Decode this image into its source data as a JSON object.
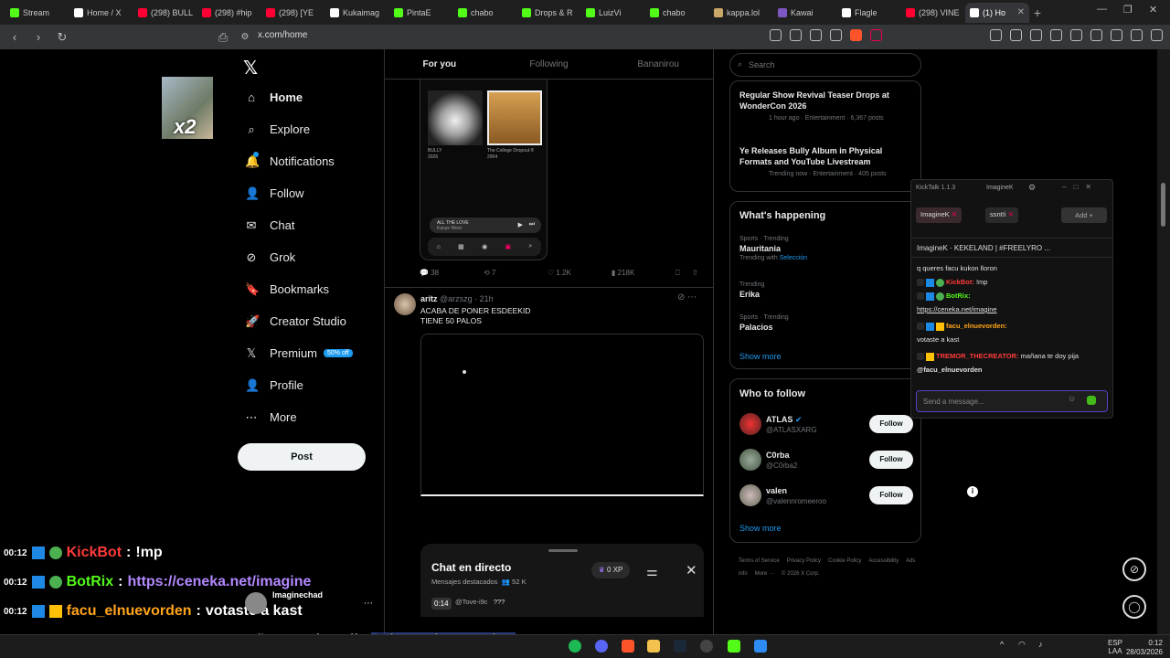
{
  "browser": {
    "tabs": [
      {
        "label": "Stream",
        "icon": "kick-icon",
        "color": "#53fc18"
      },
      {
        "label": "Home / X",
        "icon": "x-icon",
        "color": "#ffffff"
      },
      {
        "label": "(298) BULL",
        "icon": "youtube-icon",
        "color": "#ff0033"
      },
      {
        "label": "(298) #hip",
        "icon": "youtube-icon",
        "color": "#ff0033"
      },
      {
        "label": "(298) [YE",
        "icon": "youtube-icon",
        "color": "#ff0033"
      },
      {
        "label": "Kukaimag",
        "icon": "tiktok-icon",
        "color": "#ffffff"
      },
      {
        "label": "PintaE",
        "icon": "kick-icon",
        "color": "#53fc18"
      },
      {
        "label": "chabo",
        "icon": "kick-icon",
        "color": "#53fc18"
      },
      {
        "label": "Drops & R",
        "icon": "kick-icon",
        "color": "#53fc18"
      },
      {
        "label": "LuizVi",
        "icon": "kick-icon",
        "color": "#53fc18"
      },
      {
        "label": "chabo",
        "icon": "kick-icon",
        "color": "#53fc18"
      },
      {
        "label": "kappa.lol",
        "icon": "kappa-icon",
        "color": "#c9a86a"
      },
      {
        "label": "Kawai",
        "icon": "kawai-icon",
        "color": "#7e57c2"
      },
      {
        "label": "Flagle",
        "icon": "globe-icon",
        "color": "#ffffff"
      },
      {
        "label": "(298) VINE",
        "icon": "youtube-icon",
        "color": "#ff0033"
      },
      {
        "label": "(1) Ho",
        "icon": "x-icon",
        "color": "#ffffff"
      }
    ],
    "url": "x.com/home"
  },
  "overlay_x2": "x2",
  "nav": {
    "items": [
      {
        "label": "Home",
        "icon": "home-icon",
        "glyph": "⌂"
      },
      {
        "label": "Explore",
        "icon": "search-icon",
        "glyph": "⌕"
      },
      {
        "label": "Notifications",
        "icon": "bell-icon",
        "glyph": "🔔"
      },
      {
        "label": "Follow",
        "icon": "follow-icon",
        "glyph": "👤"
      },
      {
        "label": "Chat",
        "icon": "mail-icon",
        "glyph": "✉"
      },
      {
        "label": "Grok",
        "icon": "grok-icon",
        "glyph": "⊘"
      },
      {
        "label": "Bookmarks",
        "icon": "bookmark-icon",
        "glyph": "🔖"
      },
      {
        "label": "Creator Studio",
        "icon": "rocket-icon",
        "glyph": "🚀"
      },
      {
        "label": "Premium",
        "icon": "x-premium-icon",
        "glyph": "𝕏"
      },
      {
        "label": "Profile",
        "icon": "person-icon",
        "glyph": "👤"
      },
      {
        "label": "More",
        "icon": "more-circle-icon",
        "glyph": "⋯"
      }
    ],
    "premium_badge": "50% off",
    "post_label": "Post"
  },
  "feed": {
    "tabs": [
      "For you",
      "Following",
      "Bananirou"
    ],
    "phone": {
      "album1_caption": "BULLY",
      "album1_year": "2026",
      "album2_caption": "The College Dropout ®",
      "album2_year": "2004",
      "now_playing": "ALL THE LOVE",
      "now_playing_artist": "Kanye West"
    },
    "tweet1_stats": {
      "replies": "38",
      "reposts": "7",
      "likes": "1.2K",
      "views": "218K"
    },
    "tweet2": {
      "name": "aritz",
      "handle": "@arzszg · 21h",
      "line1": "ACABA DE PONER ESDEEKID",
      "line2": "TIENE 50 PALOS"
    },
    "live_chat": {
      "title": "Chat en directo",
      "subtitle": "Mensajes destacados",
      "viewers": "52 K",
      "xp": "0 XP",
      "time": "0:14",
      "user": "@Tove-i9c",
      "msg": "???"
    }
  },
  "right": {
    "search_placeholder": "Search",
    "news": [
      {
        "title": "Regular Show Revival Teaser Drops at WonderCon 2026",
        "meta": "1 hour ago · Entertainment · 6,367 posts"
      },
      {
        "title": "Ye Releases Bully Album in Physical Formats and YouTube Livestream",
        "meta": "Trending now · Entertainment · 405 posts"
      }
    ],
    "happening_title": "What's happening",
    "trends": [
      {
        "meta": "Sports · Trending",
        "name": "Mauritania",
        "sub": "Trending with",
        "link": "Selección"
      },
      {
        "meta": "Trending",
        "name": "Erika",
        "sub": "",
        "link": ""
      },
      {
        "meta": "Sports · Trending",
        "name": "Palacios",
        "sub": "",
        "link": ""
      }
    ],
    "show_more": "Show more",
    "who_title": "Who to follow",
    "who": [
      {
        "name": "ATLAS",
        "handle": "@ATLASXARG",
        "btn": "Follow"
      },
      {
        "name": "C0rba",
        "handle": "@C0rba2",
        "btn": "Follow"
      },
      {
        "name": "valen",
        "handle": "@valennromeeroo",
        "btn": "Follow"
      }
    ],
    "footer": [
      "Terms of Service",
      "Privacy Policy",
      "Cookie Policy",
      "Accessibility",
      "Ads info",
      "More ···",
      "© 2026 X Corp."
    ]
  },
  "kicktalk": {
    "title": "KickTalk 1.1.3",
    "tab": "ImagineK",
    "chips": [
      "ImagineK",
      "ssnt!i"
    ],
    "add": "Add",
    "header": "ImagineK · KEKELAND | #FREELYRO ...",
    "messages": [
      {
        "user": "",
        "text": "q queres facu kukon lloron"
      },
      {
        "user": "KickBot:",
        "text": "!mp"
      },
      {
        "user": "BotRix:",
        "text": "https://ceneka.net/imagine"
      },
      {
        "user": "facu_elnuevorden:",
        "text": "votaste a kast"
      },
      {
        "user": "TREMOR_THECREATOR:",
        "text": "mañana te doy pija",
        "mention": "@facu_elnuevorden"
      }
    ],
    "input_placeholder": "Send a message..."
  },
  "overlay_chat": [
    {
      "time": "00:12",
      "user": "KickBot",
      "text": "!mp",
      "color": "#ff3b3b"
    },
    {
      "time": "00:12",
      "user": "BotRix",
      "text": "https://ceneka.net/imagine",
      "color": "#53fc18"
    },
    {
      "time": "00:12",
      "user": "facu_elnuevorden",
      "text": "votaste a kast",
      "color": "#ffa41b"
    },
    {
      "time": "00:12",
      "user": "TREMOR_THECREATOR",
      "text": "mañana te doy pija",
      "mention": "@facu_elnuevorden",
      "color": "#ff3b3b"
    }
  ],
  "overlay_user": "Imaginechad",
  "taskbar": {
    "lang": "ESP",
    "lang2": "LAA",
    "time": "0:12",
    "date": "28/03/2026"
  }
}
